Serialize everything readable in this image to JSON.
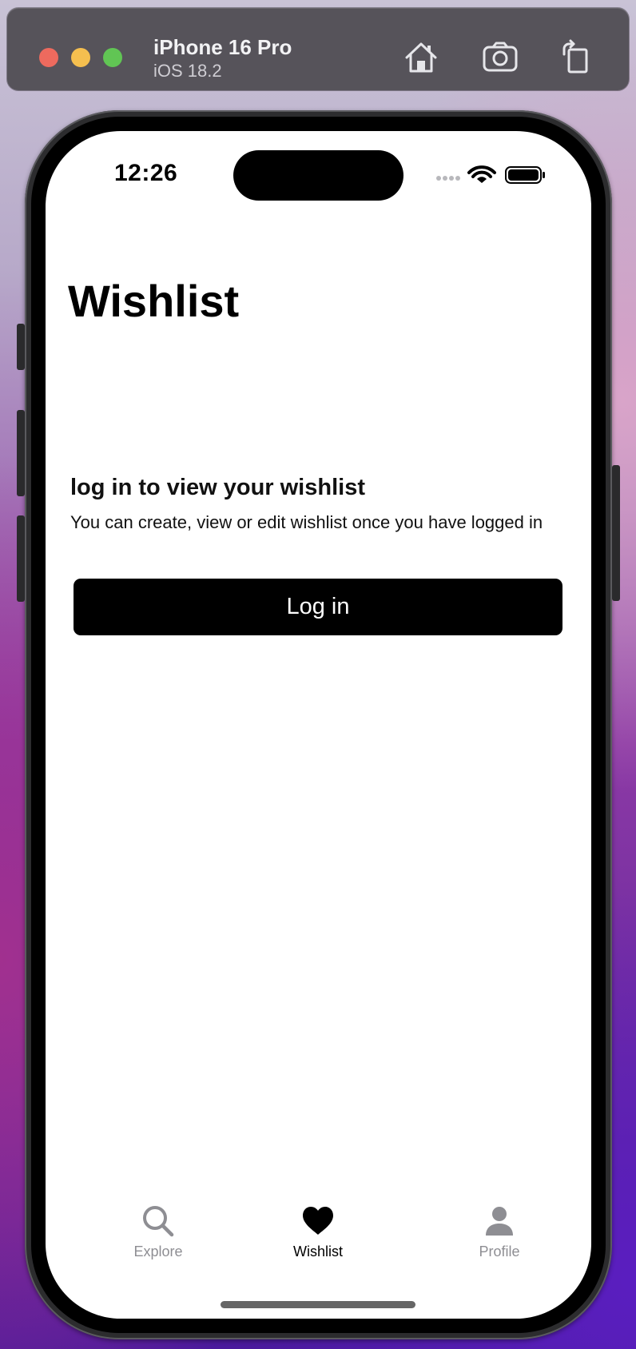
{
  "simulator": {
    "device_name": "iPhone 16 Pro",
    "os_version": "iOS 18.2",
    "buttons": {
      "home": "home-icon",
      "screenshot": "camera-icon",
      "rotate": "rotate-icon"
    }
  },
  "status_bar": {
    "time": "12:26",
    "icons": [
      "signal-dots-icon",
      "wifi-icon",
      "battery-icon"
    ]
  },
  "page": {
    "title": "Wishlist"
  },
  "empty_state": {
    "heading": "log in to view your wishlist",
    "body": "You can create, view or edit wishlist once you have logged in",
    "button_label": "Log in"
  },
  "tab_bar": {
    "tabs": [
      {
        "label": "Explore",
        "icon": "search-icon",
        "active": false
      },
      {
        "label": "Wishlist",
        "icon": "heart-icon",
        "active": true
      },
      {
        "label": "Profile",
        "icon": "person-icon",
        "active": false
      }
    ]
  },
  "colors": {
    "primary_button": "#000000",
    "active_tab": "#000000",
    "inactive_tab": "#8e8e93",
    "traffic_red": "#ed6a5e",
    "traffic_yellow": "#f5bf4f",
    "traffic_green": "#61c554"
  }
}
